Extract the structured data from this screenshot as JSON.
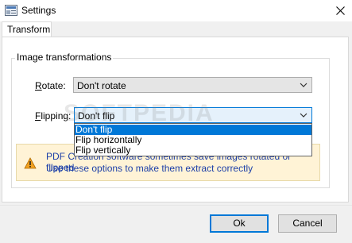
{
  "window": {
    "title": "Settings"
  },
  "tabs": [
    {
      "label": "Transform"
    }
  ],
  "group": {
    "legend": "Image transformations"
  },
  "rotate": {
    "label_prefix": "",
    "label_mnemonic": "R",
    "label_rest": "otate:",
    "value": "Don't rotate"
  },
  "flipping": {
    "label_mnemonic": "F",
    "label_rest": "lipping:",
    "value": "Don't flip",
    "options": [
      "Don't flip",
      "Flip horizontally",
      "Flip vertically"
    ],
    "selected_index": 0
  },
  "warning": {
    "line1": "PDF Creation software sometimes save images rotated or flipped",
    "line2": "Use these options to make them extract correctly"
  },
  "watermark": "SOFTPEDIA",
  "buttons": {
    "ok": "Ok",
    "cancel": "Cancel"
  },
  "colors": {
    "accent": "#0078d7",
    "warning_text": "#1c3fa8",
    "warning_bg": "#fff3d6"
  }
}
